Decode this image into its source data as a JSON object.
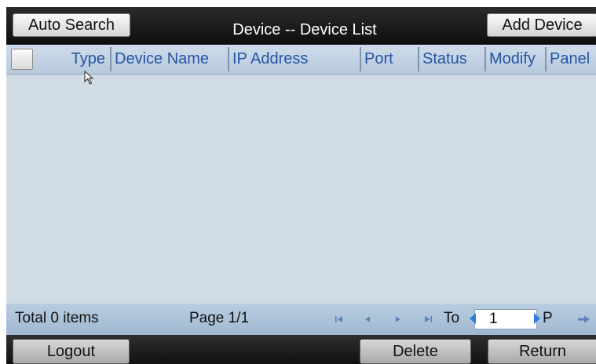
{
  "header": {
    "auto_search_label": "Auto Search",
    "title": "Device -- Device List",
    "add_device_label": "Add Device"
  },
  "table": {
    "columns": [
      "Type",
      "Device Name",
      "IP Address",
      "Port",
      "Status",
      "Modify",
      "Panel"
    ],
    "rows": []
  },
  "pager": {
    "total_label": "Total 0 items",
    "page_label": "Page 1/1",
    "to_label": "To",
    "page_input_value": "1",
    "p_label": "P"
  },
  "footer": {
    "logout_label": "Logout",
    "delete_label": "Delete",
    "return_label": "Return"
  },
  "icons": {
    "first": "first-page-icon",
    "prev": "previous-page-icon",
    "next": "next-page-icon",
    "last": "last-page-icon",
    "go": "go-arrow-icon",
    "spin_down": "spin-left-icon",
    "spin_up": "spin-right-icon"
  },
  "colors": {
    "accent_blue": "#2455a4",
    "header_bg": "#c4d4e4",
    "body_bg": "#d1dbe3",
    "pager_bg": "#adc3d9"
  }
}
